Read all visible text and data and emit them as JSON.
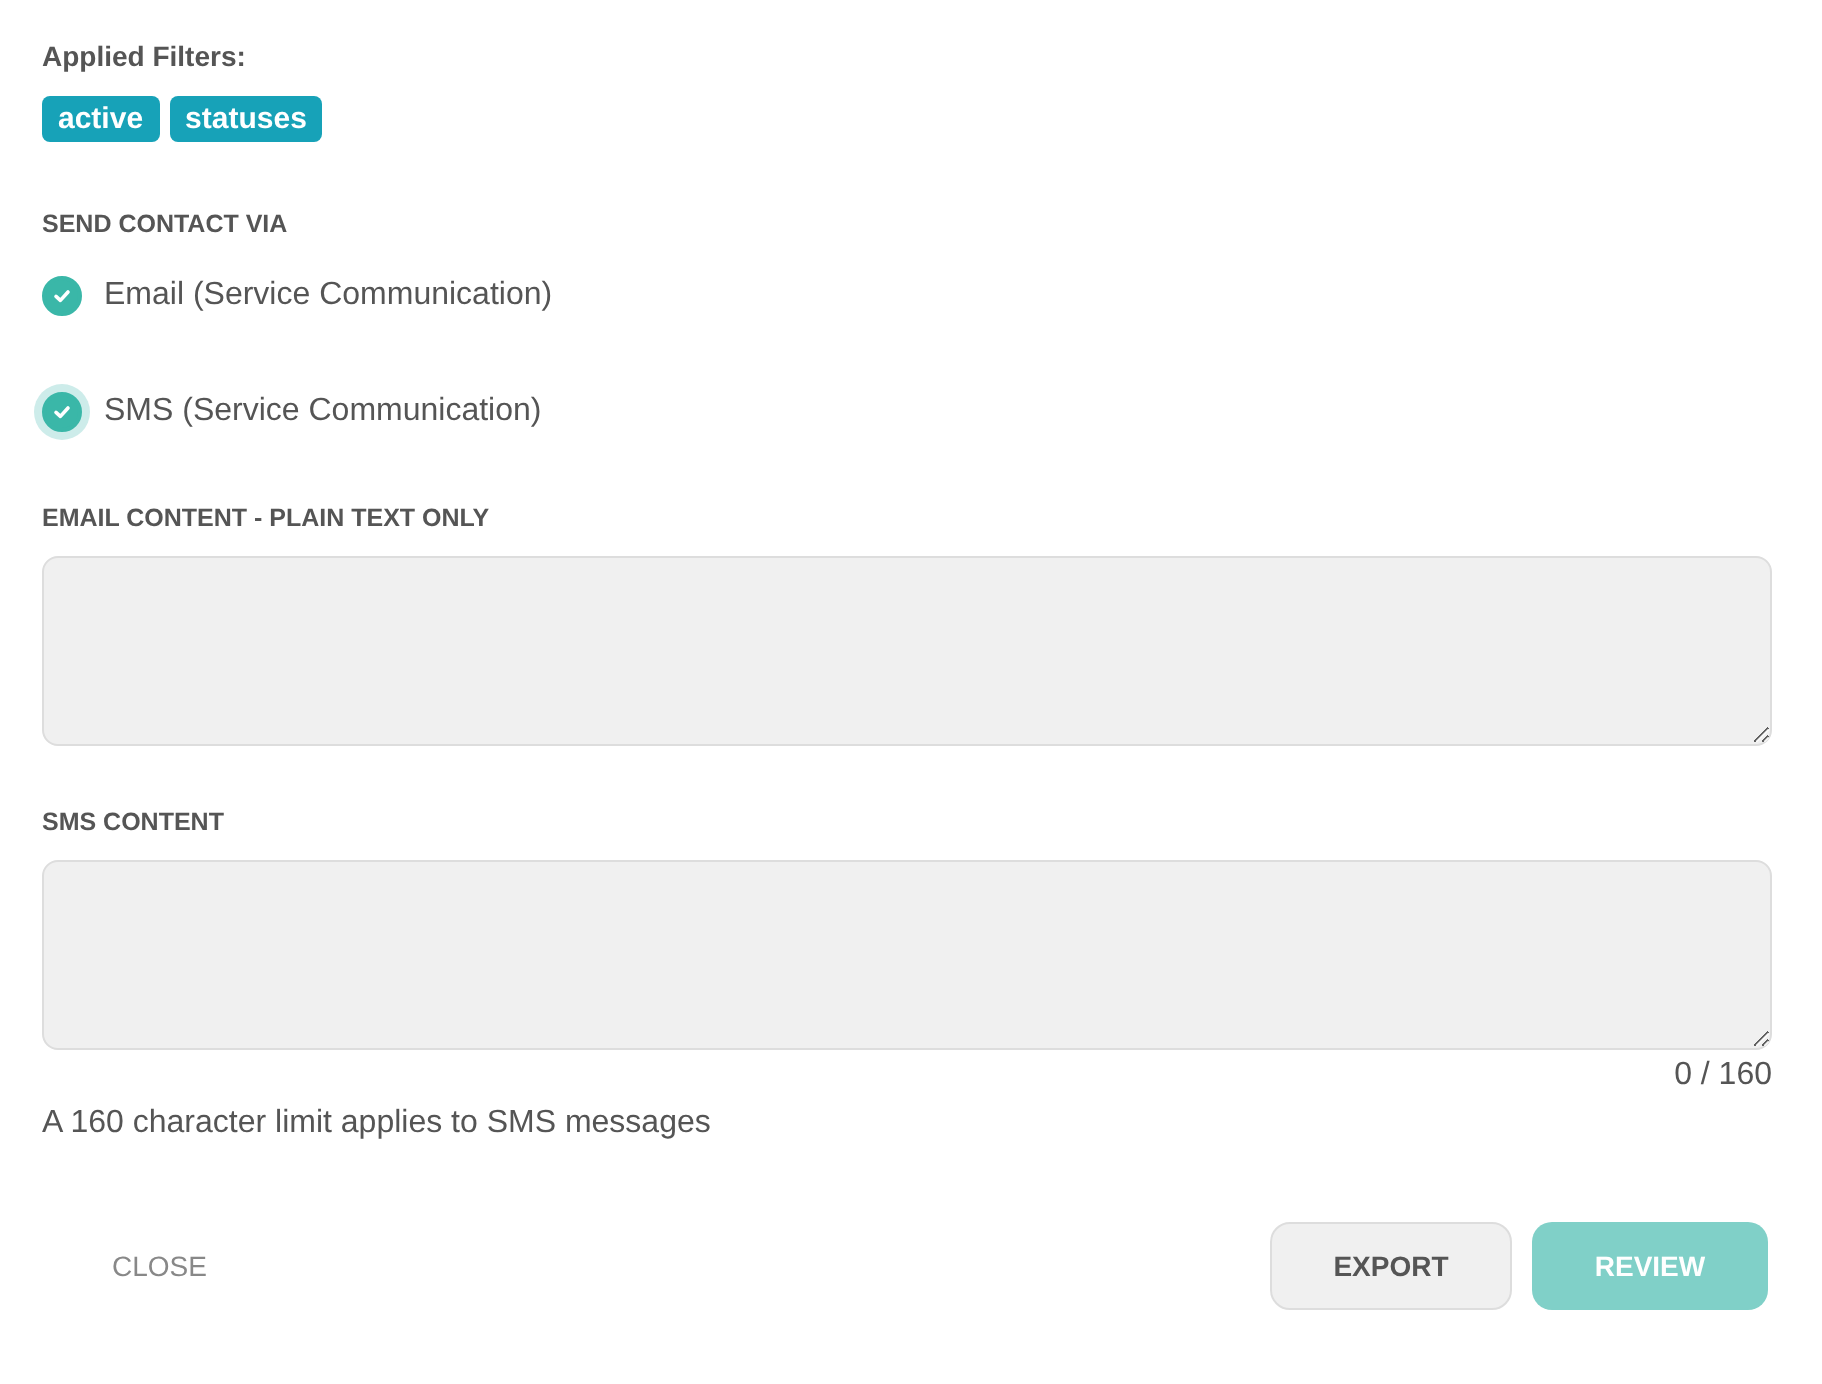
{
  "filters": {
    "label": "Applied Filters:",
    "chips": [
      "active",
      "statuses"
    ]
  },
  "send_via": {
    "label": "SEND CONTACT VIA",
    "options": [
      {
        "label": "Email (Service Communication)",
        "checked": true,
        "focused": false
      },
      {
        "label": "SMS (Service Communication)",
        "checked": true,
        "focused": true
      }
    ]
  },
  "email_content": {
    "label": "EMAIL CONTENT - PLAIN TEXT ONLY"
  },
  "sms_content": {
    "label": "SMS CONTENT",
    "counter": "0 / 160",
    "hint": "A 160 character limit applies to SMS messages"
  },
  "buttons": [
    {
      "label": "CLOSE",
      "kind": "text",
      "disabled": false
    },
    {
      "label": "EXPORT",
      "kind": "secondary",
      "disabled": false
    },
    {
      "label": "REVIEW",
      "kind": "primary",
      "disabled": true
    }
  ]
}
